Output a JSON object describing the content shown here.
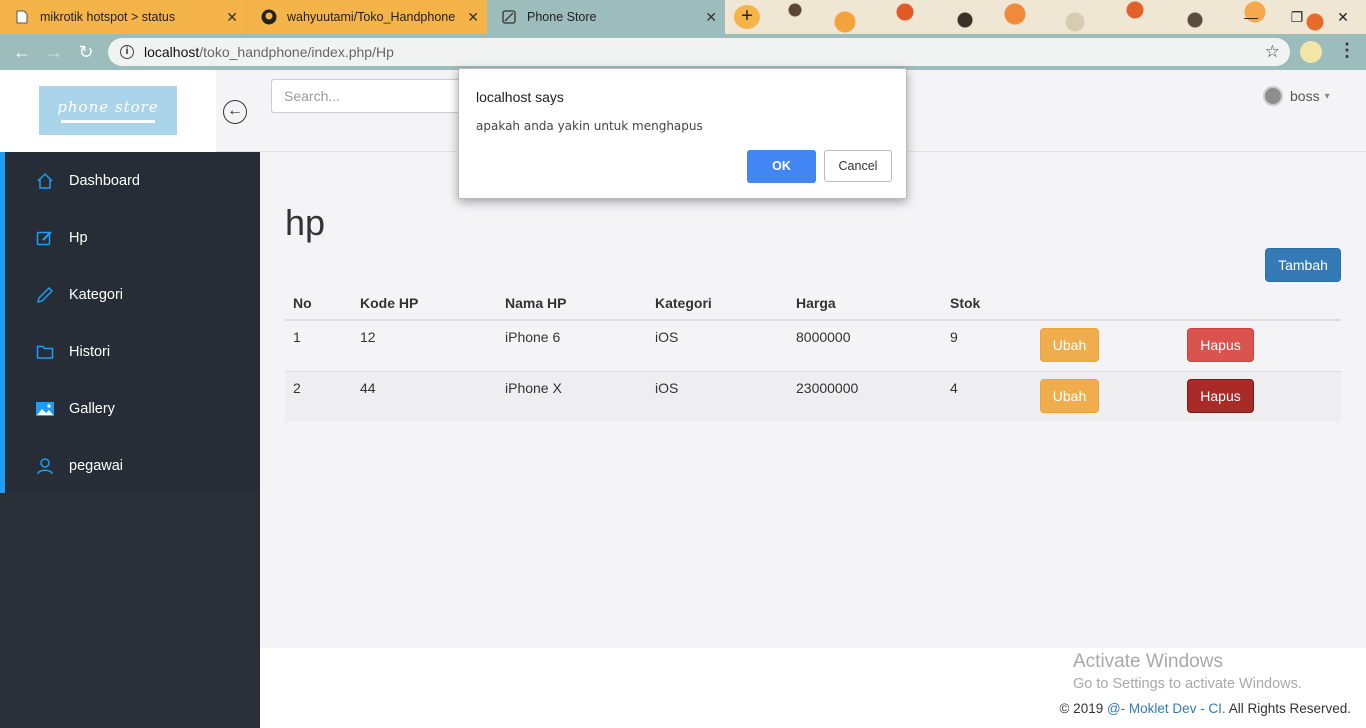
{
  "browser": {
    "tabs": [
      {
        "title": "mikrotik hotspot > status",
        "favicon": "document-icon"
      },
      {
        "title": "wahyuutami/Toko_Handphone",
        "favicon": "github-icon"
      },
      {
        "title": "Phone Store",
        "favicon": "leaf-icon"
      }
    ],
    "new_tab_label": "+",
    "url_host": "localhost",
    "url_path": "/toko_handphone/index.php/Hp"
  },
  "app": {
    "logo_text": "phone store",
    "search_placeholder": "Search...",
    "user_name": "boss"
  },
  "sidebar": {
    "items": [
      {
        "label": "Dashboard",
        "icon": "home-icon"
      },
      {
        "label": "Hp",
        "icon": "edit-icon"
      },
      {
        "label": "Kategori",
        "icon": "pencil-icon"
      },
      {
        "label": "Histori",
        "icon": "folder-icon"
      },
      {
        "label": "Gallery",
        "icon": "image-icon"
      },
      {
        "label": "pegawai",
        "icon": "user-icon"
      }
    ]
  },
  "main": {
    "title": "hp",
    "add_button": "Tambah",
    "table": {
      "headers": [
        "No",
        "Kode HP",
        "Nama HP",
        "Kategori",
        "Harga",
        "Stok"
      ],
      "rows": [
        {
          "no": "1",
          "kode": "12",
          "nama": "iPhone 6",
          "kategori": "iOS",
          "harga": "8000000",
          "stok": "9"
        },
        {
          "no": "2",
          "kode": "44",
          "nama": "iPhone X",
          "kategori": "iOS",
          "harga": "23000000",
          "stok": "4"
        }
      ],
      "edit_label": "Ubah",
      "delete_label": "Hapus"
    }
  },
  "footer": {
    "copy_prefix": "© 2019 ",
    "copy_link": "@- Moklet Dev - CI.",
    "copy_suffix": " All Rights Reserved.",
    "watermark_title": "Activate Windows",
    "watermark_sub": "Go to Settings to activate Windows."
  },
  "dialog": {
    "title": "localhost says",
    "message": "apakah anda yakin untuk menghapus",
    "ok_label": "OK",
    "cancel_label": "Cancel"
  },
  "colors": {
    "sidebar_accent": "#1e9df2",
    "primary": "#337ab7",
    "warning": "#f0ad4e",
    "danger": "#d9534f",
    "dialog_ok": "#4285f4"
  }
}
